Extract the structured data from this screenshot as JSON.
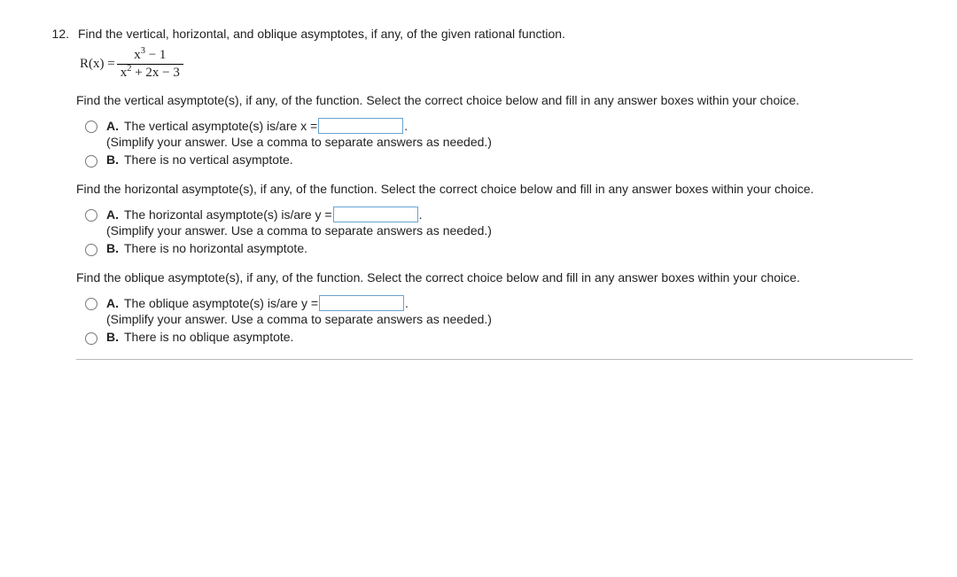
{
  "question_number": "12.",
  "question_text": "Find the vertical, horizontal, and oblique asymptotes, if any, of the given rational function.",
  "formula": {
    "lhs": "R(x) = ",
    "numerator_pre": "x",
    "numerator_sup": "3",
    "numerator_post": " − 1",
    "denominator_pre": "x",
    "denominator_sup": "2",
    "denominator_post": " + 2x − 3"
  },
  "sections": [
    {
      "prompt": "Find the vertical asymptote(s), if any, of the function. Select the correct choice below and fill in any answer boxes within your choice.",
      "choices": {
        "a": {
          "label": "A.",
          "pre_text": "The vertical asymptote(s) is/are x = ",
          "post_text": ".",
          "has_input": true,
          "hint": "(Simplify your answer. Use a comma to separate answers as needed.)"
        },
        "b": {
          "label": "B.",
          "text": "There is no vertical asymptote."
        }
      }
    },
    {
      "prompt": "Find the horizontal asymptote(s), if any, of the function. Select the correct choice below and fill in any answer boxes within your choice.",
      "choices": {
        "a": {
          "label": "A.",
          "pre_text": "The horizontal asymptote(s) is/are y = ",
          "post_text": ".",
          "has_input": true,
          "hint": "(Simplify your answer. Use a comma to separate answers as needed.)"
        },
        "b": {
          "label": "B.",
          "text": "There is no horizontal asymptote."
        }
      }
    },
    {
      "prompt": "Find the oblique asymptote(s), if any, of the function. Select the correct choice below and fill in any answer boxes within your choice.",
      "choices": {
        "a": {
          "label": "A.",
          "pre_text": "The oblique asymptote(s) is/are y = ",
          "post_text": ".",
          "has_input": true,
          "hint": "(Simplify your answer. Use a comma to separate answers as needed.)"
        },
        "b": {
          "label": "B.",
          "text": "There is no oblique asymptote."
        }
      }
    }
  ]
}
